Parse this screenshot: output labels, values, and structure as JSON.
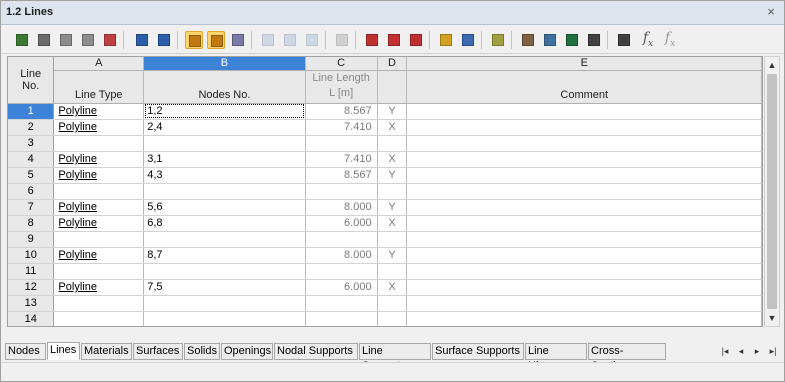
{
  "window": {
    "title": "1.2 Lines",
    "close_glyph": "×"
  },
  "toolbar": {
    "buttons": [
      {
        "icon": "edit-table-icon",
        "color": "#3b7a2f"
      },
      {
        "icon": "insert-row-icon",
        "color": "#6a6a6a"
      },
      {
        "icon": "delete-row-icon",
        "color": "#8c8c8c"
      },
      {
        "icon": "row-settings-icon",
        "color": "#8c8c8c"
      },
      {
        "icon": "clear-rows-icon",
        "color": "#c04040"
      },
      {
        "icon": "import-icon",
        "color": "#2a5ea8"
      },
      {
        "icon": "export-icon",
        "color": "#2a5ea8"
      },
      {
        "icon": "filter-select-icon",
        "color": "#c07a10"
      },
      {
        "icon": "filter-objects-icon",
        "color": "#c07a10"
      },
      {
        "icon": "refresh-icon",
        "color": "#7a7aa8"
      },
      {
        "icon": "jump-first-icon",
        "color": "#9db0d0"
      },
      {
        "icon": "jump-next-icon",
        "color": "#9db0d0"
      },
      {
        "icon": "jump-last-icon",
        "color": "#9db0d0"
      },
      {
        "icon": "grid-select-icon",
        "color": "#a0a0a0"
      },
      {
        "icon": "delete-nodes-icon",
        "color": "#c03030"
      },
      {
        "icon": "divide-line-icon",
        "color": "#c03030"
      },
      {
        "icon": "merge-lines-icon",
        "color": "#c03030"
      },
      {
        "icon": "table-view-icon",
        "color": "#d4a020"
      },
      {
        "icon": "column-view-icon",
        "color": "#3a6ab0"
      },
      {
        "icon": "edit-note-icon",
        "color": "#a0a040"
      },
      {
        "icon": "settings-icon",
        "color": "#806040"
      },
      {
        "icon": "units-icon",
        "color": "#4070a0"
      },
      {
        "icon": "excel-export-icon",
        "color": "#207040"
      },
      {
        "icon": "calculator-icon",
        "color": "#404040"
      },
      {
        "icon": "text-format-icon",
        "color": "#404040"
      }
    ],
    "fx_label": "f",
    "fx_sub": "x",
    "fx2_label": "f",
    "fx2_sub": "x"
  },
  "table": {
    "column_letters": [
      "A",
      "B",
      "C",
      "D",
      "E"
    ],
    "row_header_label": "Line No.",
    "col_headers": [
      "Line Type",
      "Nodes No.",
      "Line Length\nL [m]",
      "",
      "Comment"
    ],
    "rows": [
      {
        "no": "1",
        "type": "Polyline",
        "nodes": "1,2",
        "length": "8.567",
        "dir": "Y",
        "comment": ""
      },
      {
        "no": "2",
        "type": "Polyline",
        "nodes": "2,4",
        "length": "7.410",
        "dir": "X",
        "comment": ""
      },
      {
        "no": "3",
        "type": "",
        "nodes": "",
        "length": "",
        "dir": "",
        "comment": ""
      },
      {
        "no": "4",
        "type": "Polyline",
        "nodes": "3,1",
        "length": "7.410",
        "dir": "X",
        "comment": ""
      },
      {
        "no": "5",
        "type": "Polyline",
        "nodes": "4,3",
        "length": "8.567",
        "dir": "Y",
        "comment": ""
      },
      {
        "no": "6",
        "type": "",
        "nodes": "",
        "length": "",
        "dir": "",
        "comment": ""
      },
      {
        "no": "7",
        "type": "Polyline",
        "nodes": "5,6",
        "length": "8.000",
        "dir": "Y",
        "comment": ""
      },
      {
        "no": "8",
        "type": "Polyline",
        "nodes": "6,8",
        "length": "6.000",
        "dir": "X",
        "comment": ""
      },
      {
        "no": "9",
        "type": "",
        "nodes": "",
        "length": "",
        "dir": "",
        "comment": ""
      },
      {
        "no": "10",
        "type": "Polyline",
        "nodes": "8,7",
        "length": "8.000",
        "dir": "Y",
        "comment": ""
      },
      {
        "no": "11",
        "type": "",
        "nodes": "",
        "length": "",
        "dir": "",
        "comment": ""
      },
      {
        "no": "12",
        "type": "Polyline",
        "nodes": "7,5",
        "length": "6.000",
        "dir": "X",
        "comment": ""
      },
      {
        "no": "13",
        "type": "",
        "nodes": "",
        "length": "",
        "dir": "",
        "comment": ""
      },
      {
        "no": "14",
        "type": "",
        "nodes": "",
        "length": "",
        "dir": "",
        "comment": ""
      }
    ]
  },
  "tabs": [
    "Nodes",
    "Lines",
    "Materials",
    "Surfaces",
    "Solids",
    "Openings",
    "Nodal Supports",
    "Line Supports",
    "Surface Supports",
    "Line Hinges",
    "Cross-Sections"
  ],
  "active_tab": "Lines",
  "nav_glyphs": [
    "|◂",
    "◂",
    "▸",
    "▸|"
  ],
  "scroll": {
    "up": "▲",
    "down": "▼"
  }
}
